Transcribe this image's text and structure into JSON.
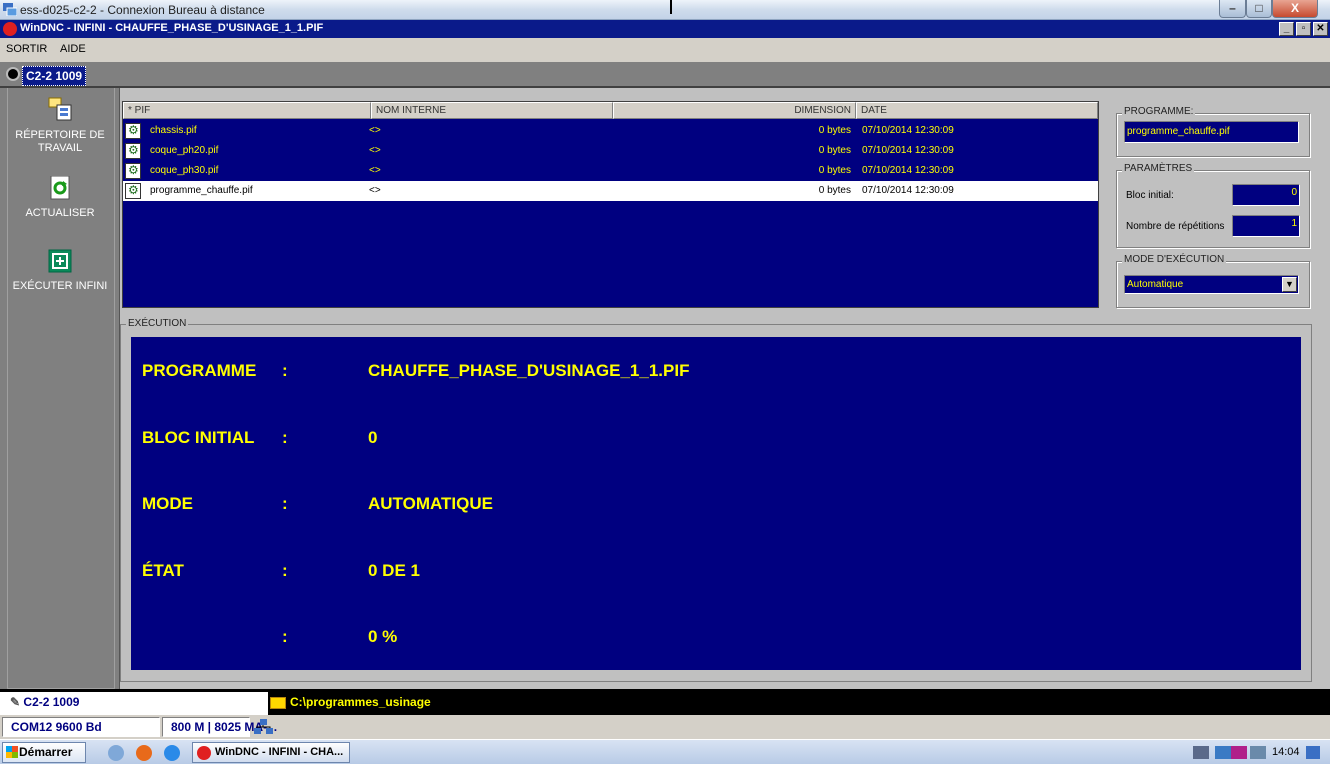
{
  "rdp": {
    "title": "ess-d025-c2-2 - Connexion Bureau à distance",
    "min": "–",
    "max": "□",
    "close": "X"
  },
  "app": {
    "title": "WinDNC - INFINI - CHAUFFE_PHASE_D'USINAGE_1_1.PIF",
    "min": "_",
    "max": "▫",
    "close": "✕"
  },
  "menu": {
    "sortir": "SORTIR",
    "aide": "AIDE"
  },
  "machine": {
    "name": "C2-2 1009"
  },
  "sidebar": {
    "working_dir": "RÉPERTOIRE DE\nTRAVAIL",
    "refresh": "ACTUALISER",
    "execute": "EXÉCUTER INFINI"
  },
  "filelist": {
    "headers": {
      "pif": "* PIF",
      "nom_interne": "NOM INTERNE",
      "dimension": "DIMENSION",
      "date": "DATE"
    },
    "rows": [
      {
        "name": "chassis.pif",
        "internal": "<>",
        "size": "0 bytes",
        "date": "07/10/2014  12:30:09"
      },
      {
        "name": "coque_ph20.pif",
        "internal": "<>",
        "size": "0 bytes",
        "date": "07/10/2014  12:30:09"
      },
      {
        "name": "coque_ph30.pif",
        "internal": "<>",
        "size": "0 bytes",
        "date": "07/10/2014  12:30:09"
      },
      {
        "name": "programme_chauffe.pif",
        "internal": "<>",
        "size": "0 bytes",
        "date": "07/10/2014  12:30:09"
      }
    ],
    "selected_index": 3
  },
  "right": {
    "programme_label": "PROGRAMME:",
    "programme_value": "programme_chauffe.pif",
    "params_label": "PARAMÈTRES",
    "bloc_initial_label": "Bloc initial:",
    "bloc_initial_value": "0",
    "repetitions_label": "Nombre de répétitions",
    "repetitions_value": "1",
    "mode_label": "MODE D'EXÉCUTION",
    "mode_value": "Automatique"
  },
  "execution": {
    "frame_label": "EXÉCUTION",
    "rows": [
      {
        "key": "PROGRAMME",
        "sep": ":",
        "value": "CHAUFFE_PHASE_D'USINAGE_1_1.PIF"
      },
      {
        "key": "BLOC INITIAL",
        "sep": ":",
        "value": "0"
      },
      {
        "key": "MODE",
        "sep": ":",
        "value": "AUTOMATIQUE"
      },
      {
        "key": "ÉTAT",
        "sep": ":",
        "value": "0 DE 1"
      },
      {
        "key": "",
        "sep": ":",
        "value": "0 %"
      }
    ]
  },
  "status": {
    "machine": "C2-2 1009",
    "path": "C:\\programmes_usinage",
    "com": "COM12 9600 Bd",
    "mem": "800 M | 8025 MA-..."
  },
  "taskbar": {
    "start": "Démarrer",
    "task": "WinDNC - INFINI - CHA...",
    "clock": "14:04"
  },
  "colors": {
    "display_bg": "#000080",
    "display_text": "#ffff00",
    "title_blue": "#0a1a8a"
  }
}
